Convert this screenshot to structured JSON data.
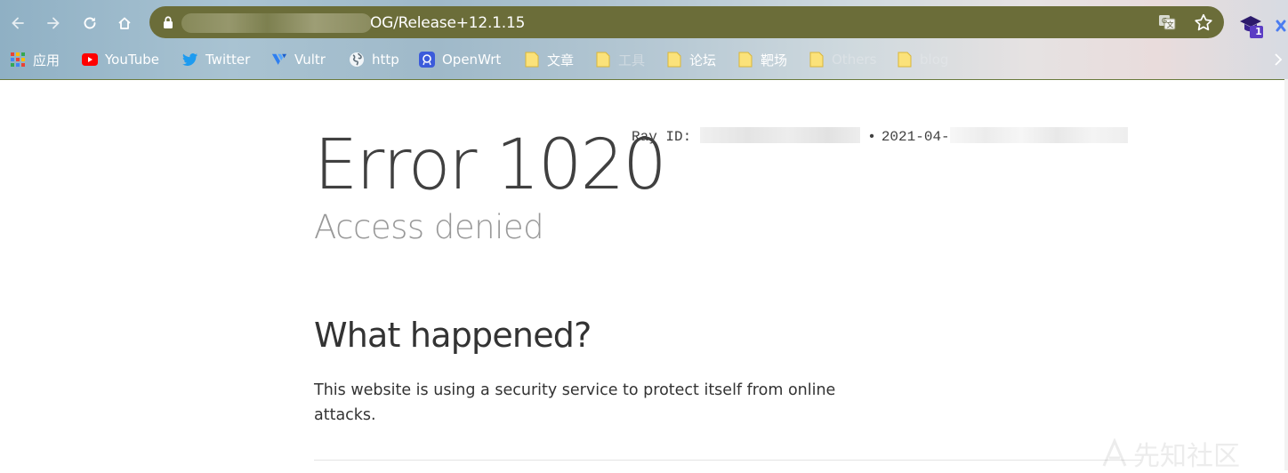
{
  "browser": {
    "nav": {
      "back_icon": "arrow-left-icon",
      "forward_icon": "arrow-right-icon",
      "reload_icon": "reload-icon",
      "home_icon": "home-icon"
    },
    "omnibox": {
      "url_visible": "OG/Release+12.1.15",
      "lock_icon": "lock-icon",
      "translate_icon": "translate-icon",
      "bookmark_icon": "star-icon"
    },
    "extension": {
      "badge": "1"
    },
    "bookmarks": [
      {
        "label": "应用",
        "icon": "apps-grid-icon"
      },
      {
        "label": "YouTube",
        "icon": "youtube-icon"
      },
      {
        "label": "Twitter",
        "icon": "twitter-icon"
      },
      {
        "label": "Vultr",
        "icon": "vultr-icon"
      },
      {
        "label": "http",
        "icon": "globe-icon"
      },
      {
        "label": "OpenWrt",
        "icon": "openwrt-icon"
      },
      {
        "label": "文章",
        "icon": "folder-icon"
      },
      {
        "label": "工具",
        "icon": "folder-icon"
      },
      {
        "label": "论坛",
        "icon": "folder-icon"
      },
      {
        "label": "靶场",
        "icon": "folder-icon"
      },
      {
        "label": "Others",
        "icon": "folder-icon"
      },
      {
        "label": "blog",
        "icon": "folder-icon"
      }
    ]
  },
  "page": {
    "error_title": "Error 1020",
    "ray_label": "Ray ID:",
    "ray_separator": "•",
    "ray_date": "2021-04-",
    "subtitle": "Access denied",
    "section_heading": "What happened?",
    "section_text": "This website is using a security service to protect itself from online attacks.",
    "watermark": "先知社区"
  },
  "colors": {
    "omnibox": "#6b6d39",
    "title_text": "#404040",
    "subtitle_text": "#999999"
  }
}
